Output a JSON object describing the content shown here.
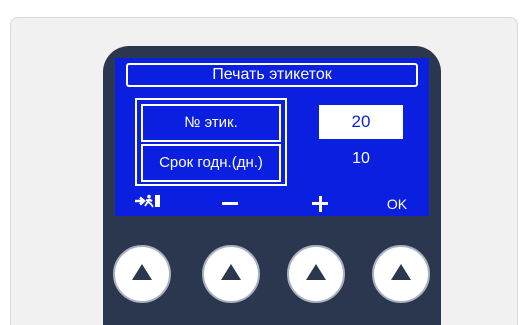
{
  "screen": {
    "title": "Печать этикеток",
    "rows": [
      {
        "label": "№ этик.",
        "value": "20",
        "selected": true
      },
      {
        "label": "Срок годн.(дн.)",
        "value": "10",
        "selected": false
      }
    ]
  },
  "softkeys": {
    "exit_icon": "exit-running-man-icon",
    "minus_icon": "minus-icon",
    "plus_icon": "plus-icon",
    "ok_label": "OK"
  },
  "hardware_buttons": {
    "icon": "triangle-up-icon",
    "count": 4
  },
  "colors": {
    "screen_bg": "#0a1fe0",
    "device_body": "#2a374e",
    "frame_bg": "#f1f1f2",
    "text": "#ffffff"
  }
}
